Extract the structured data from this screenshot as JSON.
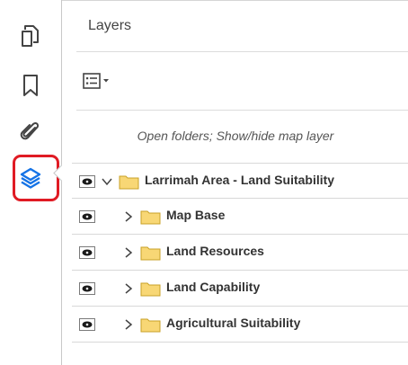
{
  "panel": {
    "title": "Layers",
    "hint": "Open folders; Show/hide map layer"
  },
  "rail": {
    "items": [
      {
        "name": "pages",
        "icon": "copy-pages-icon"
      },
      {
        "name": "bookmarks",
        "icon": "bookmark-icon"
      },
      {
        "name": "attachments",
        "icon": "paperclip-icon"
      },
      {
        "name": "layers",
        "icon": "layers-icon",
        "active": true
      }
    ]
  },
  "colors": {
    "accent": "#1473e6",
    "highlight": "#e01b24",
    "folder": "#f8d775"
  },
  "layers": [
    {
      "label": "Larrimah Area - Land Suitability",
      "expanded": true,
      "visible": true
    },
    {
      "label": "Map Base",
      "expanded": false,
      "visible": true
    },
    {
      "label": "Land Resources",
      "expanded": false,
      "visible": true
    },
    {
      "label": "Land Capability",
      "expanded": false,
      "visible": true
    },
    {
      "label": "Agricultural Suitability",
      "expanded": false,
      "visible": true
    }
  ]
}
